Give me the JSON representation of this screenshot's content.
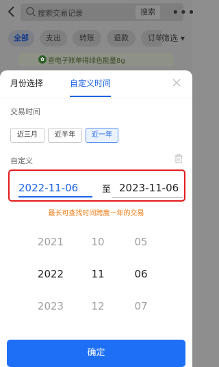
{
  "header": {
    "search_placeholder": "搜索交易记录",
    "search_button": "搜索",
    "more": "•••"
  },
  "filters": {
    "chips": [
      "全部",
      "支出",
      "转账",
      "退款",
      "订单"
    ],
    "filter_label": "筛选 ▾"
  },
  "banner": {
    "text": "查电子账单得绿色能量8g"
  },
  "sheet": {
    "tabs": [
      {
        "label": "月份选择",
        "active": false
      },
      {
        "label": "自定义时间",
        "active": true
      }
    ],
    "trade_time_label": "交易时间",
    "periods": [
      {
        "label": "近三月",
        "selected": false
      },
      {
        "label": "近半年",
        "selected": false
      },
      {
        "label": "近一年",
        "selected": true
      }
    ],
    "custom_label": "自定义",
    "start_date": "2022-11-06",
    "to_label": "至",
    "end_date": "2023-11-06",
    "hint": "最长可查找时间跨度一年的交易",
    "picker": {
      "years": [
        "2021",
        "2022",
        "2023"
      ],
      "months": [
        "10",
        "11",
        "12"
      ],
      "days": [
        "05",
        "06",
        "07"
      ]
    },
    "confirm": "确定"
  },
  "colors": {
    "accent": "#1b63e6",
    "highlight_border": "#e41c1c",
    "hint": "#ef7a11",
    "button": "#1e6ff5"
  }
}
